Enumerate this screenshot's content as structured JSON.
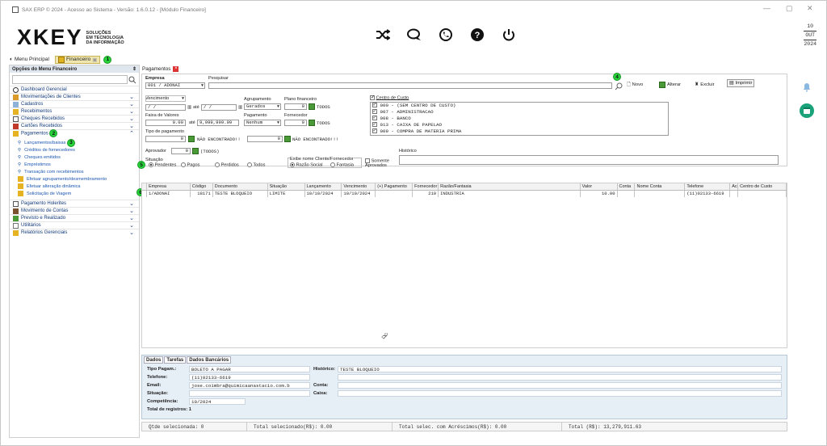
{
  "window": {
    "title": "SAX ERP © 2024 - Acesso ao Sistema - Versão: 1.6.0.12 - [Módulo Financeiro]"
  },
  "logo": {
    "mark": "XKEY",
    "line1": "SOLUÇÕES",
    "line2": "EM TECNOLOGIA",
    "line3": "DA INFORMAÇÃO"
  },
  "date": {
    "day": "10",
    "month": "OUT",
    "year": "2024"
  },
  "topTabs": [
    {
      "label": "Menu Principal"
    },
    {
      "label": "Financeiro",
      "badge": "1"
    }
  ],
  "sidebar": {
    "title": "Opções do Menu Financeiro",
    "items": [
      {
        "label": "Dashboard Gerencial",
        "chev": ""
      },
      {
        "label": "Movimentações de Clientes",
        "chev": "⌄"
      },
      {
        "label": "Cadastros",
        "chev": "⌄"
      },
      {
        "label": "Recebimentos",
        "chev": "⌄"
      },
      {
        "label": "Cheques Recebidos",
        "chev": "⌄"
      },
      {
        "label": "Cartões Recebidos",
        "chev": "⌄"
      },
      {
        "label": "Pagamentos",
        "chev": "⌃",
        "badge": "2"
      }
    ],
    "subItems": [
      {
        "label": "Lançamentos/baixas",
        "badge": "3"
      },
      {
        "label": "Créditos de fornecedores"
      },
      {
        "label": "Cheques emitidos"
      },
      {
        "label": "Empréstimos"
      },
      {
        "label": "Transação com recebimentos"
      },
      {
        "label": "Efetuar agrupamento/desmembramento"
      },
      {
        "label": "Efetuar alteração dinâmica"
      },
      {
        "label": "Solicitação de Viagem"
      }
    ],
    "itemsAfter": [
      {
        "label": "Pagamento Holerites",
        "chev": "⌄"
      },
      {
        "label": "Movimento de Contas",
        "chev": "⌄"
      },
      {
        "label": "Previsto e Realizado",
        "chev": "⌄"
      },
      {
        "label": "Utilitários",
        "chev": "⌄"
      },
      {
        "label": "Relatórios Gerenciais",
        "chev": "⌄"
      }
    ]
  },
  "mainTab": {
    "label": "Pagamentos"
  },
  "form": {
    "empresaLabel": "Empresa",
    "empresaValue": "001 / ADONAI",
    "pesquisarLabel": "Pesquisar",
    "badge4": "4",
    "btnNovo": "Novo",
    "btnAlterar": "Alterar",
    "btnExcluir": "Excluir",
    "btnImprimir": "Imprimir",
    "vencimentoLabel": "Vencimento",
    "dateFrom": "/ /",
    "ate": "até",
    "dateTo": "/ /",
    "agrupamentoLabel": "Agrupamento",
    "agrupamentoValue": "Gerados",
    "planoLabel": "Plano financeiro",
    "planoValue": "0",
    "todos": "TODOS",
    "faixaLabel": "Faixa de Valores",
    "faixaFrom": "0.00",
    "faixaTo": "9,999,999.99",
    "pagamentoLabel": "Pagamento",
    "pagamentoValue": "Nenhum",
    "fornecedorLabel": "Fornecedor",
    "fornecedorValue": "0",
    "tipoPagLabel": "Tipo de pagamento",
    "tipoPagValue": "0",
    "naoEncontrado1": "NÃO ENCONTRADO!!",
    "tipo2Value": "0",
    "naoEncontrado2": "NÃO ENCONTRADO!!!",
    "aprovadorLabel": "Aprovador",
    "aprovadorValue": "0",
    "aprovadorTodos": "(TODOS)",
    "situacaoLabel": "Situação",
    "badge5": "5",
    "sitPendentes": "Pendentes",
    "sitPagos": "Pagos",
    "sitPerdidos": "Perdidos",
    "sitTodos": "Todos",
    "exibeLabel": "Exibe nome Cliente/Fornecedor",
    "exRazao": "Razão Social",
    "exFantasia": "Fantasia",
    "somenteAprovados": "Somente Aprovados",
    "historicoLabel": "Histórico",
    "centroLabel": "Centro de Custo",
    "centros": [
      "000 - (SEM CENTRO DE CUSTO)",
      "007 - ADMINISTRACAO",
      "008 - BANCO",
      "013 - CAIXA DE PAPELAO",
      "009 - COMPRA DE MATERIA PRIMA"
    ]
  },
  "grid": {
    "badge6": "6",
    "headers": [
      "Empresa",
      "Código",
      "Documento",
      "Situação",
      "Lançamento",
      "Vencimento",
      "(+) Pagamento",
      "Fornecedor",
      "Razão/Fantasia",
      "Valor",
      "Conta",
      "Nome Conta",
      "Telefone",
      "Aco",
      "Centro de Custo"
    ],
    "rows": [
      [
        "1/ADONAI",
        "18171",
        "TESTE BLOQUEIO",
        "LIMITE",
        "10/10/2024",
        "10/10/2024",
        "",
        "210",
        "INDUSTRIA",
        "10.00",
        "",
        "",
        "(11)02133-6619",
        "",
        ""
      ]
    ]
  },
  "detail": {
    "tabs": [
      "Dados",
      "Tarefas",
      "Dados Bancários"
    ],
    "tipoPagLabel": "Tipo Pagam.:",
    "tipoPagValue": "BOLETO A PAGAR",
    "historicoLabel": "Histórico:",
    "historicoValue": "TESTE BLOQUEIO",
    "telefoneLabel": "Telefone:",
    "telefoneValue": "(11)02133-6619",
    "emailLabel": "Email:",
    "emailValue": "jose.coimbra@quimicaanastacio.com.b",
    "contaLabel": "Conta:",
    "situacaoLabel": "Situação:",
    "caixaLabel": "Caixa:",
    "competenciaLabel": "Competência:",
    "competenciaValue": "10/2024",
    "totalLabel": "Total de registros: 1"
  },
  "status": {
    "qtde": "Qtde selecionada: 0",
    "totalSel": "Total selecionado(R$): 0.00",
    "totalAcr": "Total selec. com Acréscimos(R$): 0.00",
    "total": "Total (R$): 13,279,911.63"
  },
  "colors": {
    "accent": "#1a56b0",
    "badge": "#27d33a",
    "sideIcon": "#1aa37a"
  }
}
